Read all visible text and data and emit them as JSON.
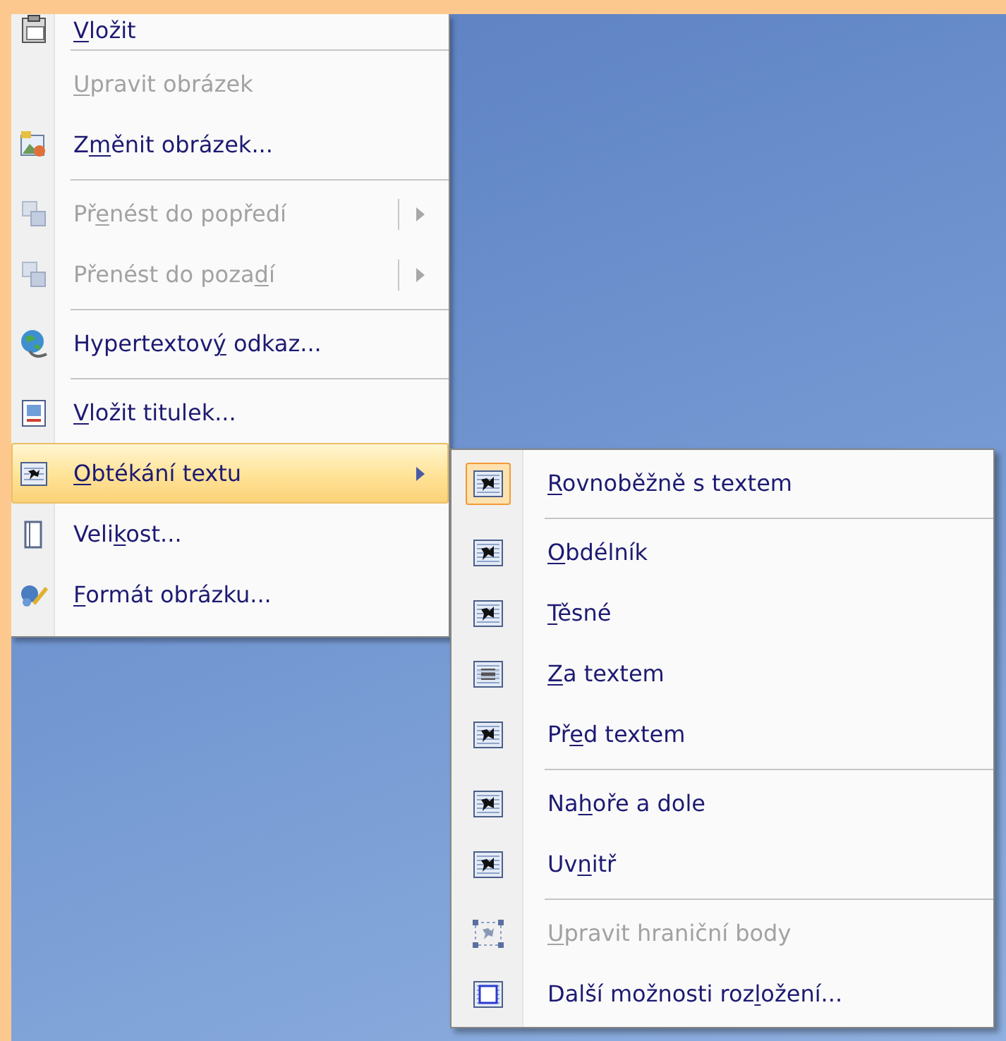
{
  "context_menu": {
    "items": [
      {
        "kind": "item",
        "label": [
          {
            "text": "V",
            "access_key": true
          },
          {
            "text": "ložit",
            "access_key": false
          }
        ],
        "disabled": false,
        "selected": false
      },
      {
        "kind": "separator"
      },
      {
        "kind": "item",
        "label": [
          {
            "text": "U",
            "access_key": true
          },
          {
            "text": "pravit obrázek",
            "access_key": false
          }
        ],
        "disabled": true,
        "selected": false
      },
      {
        "kind": "item",
        "label": [
          {
            "text": "Z",
            "access_key": false
          },
          {
            "text": "m",
            "access_key": true
          },
          {
            "text": "ěnit obrázek...",
            "access_key": false
          }
        ],
        "disabled": false,
        "selected": false
      },
      {
        "kind": "separator"
      },
      {
        "kind": "split",
        "label": [
          {
            "text": "Př",
            "access_key": false
          },
          {
            "text": "e",
            "access_key": true
          },
          {
            "text": "nést do popředí",
            "access_key": false
          }
        ],
        "disabled": true,
        "selected": false
      },
      {
        "kind": "split",
        "label": [
          {
            "text": "Přenést do poza",
            "access_key": false
          },
          {
            "text": "d",
            "access_key": true
          },
          {
            "text": "í",
            "access_key": false
          }
        ],
        "disabled": true,
        "selected": false
      },
      {
        "kind": "separator"
      },
      {
        "kind": "item",
        "label": [
          {
            "text": "Hypertextov",
            "access_key": false
          },
          {
            "text": "ý",
            "access_key": true
          },
          {
            "text": " odkaz...",
            "access_key": false
          }
        ],
        "disabled": false,
        "selected": false
      },
      {
        "kind": "separator"
      },
      {
        "kind": "item",
        "label": [
          {
            "text": "V",
            "access_key": true
          },
          {
            "text": "ložit titulek...",
            "access_key": false
          }
        ],
        "disabled": false,
        "selected": false
      },
      {
        "kind": "submenu",
        "label": [
          {
            "text": "O",
            "access_key": true
          },
          {
            "text": "btékání textu",
            "access_key": false
          }
        ],
        "disabled": false,
        "selected": true
      },
      {
        "kind": "item",
        "label": [
          {
            "text": "Veli",
            "access_key": false
          },
          {
            "text": "k",
            "access_key": true
          },
          {
            "text": "ost...",
            "access_key": false
          }
        ],
        "disabled": false,
        "selected": false
      },
      {
        "kind": "item",
        "label": [
          {
            "text": "F",
            "access_key": true
          },
          {
            "text": "ormát obrázku...",
            "access_key": false
          }
        ],
        "disabled": false,
        "selected": false
      }
    ]
  },
  "submenu": {
    "items": [
      {
        "kind": "item",
        "label": [
          {
            "text": "R",
            "access_key": true
          },
          {
            "text": "ovnoběžně s textem",
            "access_key": false
          }
        ],
        "checked": true,
        "disabled": false
      },
      {
        "kind": "separator"
      },
      {
        "kind": "item",
        "label": [
          {
            "text": "O",
            "access_key": true
          },
          {
            "text": "bdélník",
            "access_key": false
          }
        ],
        "checked": false,
        "disabled": false
      },
      {
        "kind": "item",
        "label": [
          {
            "text": "T",
            "access_key": true
          },
          {
            "text": "ěsné",
            "access_key": false
          }
        ],
        "checked": false,
        "disabled": false
      },
      {
        "kind": "item",
        "label": [
          {
            "text": "Z",
            "access_key": true
          },
          {
            "text": "a textem",
            "access_key": false
          }
        ],
        "checked": false,
        "disabled": false
      },
      {
        "kind": "item",
        "label": [
          {
            "text": "Př",
            "access_key": false
          },
          {
            "text": "e",
            "access_key": true
          },
          {
            "text": "d textem",
            "access_key": false
          }
        ],
        "checked": false,
        "disabled": false
      },
      {
        "kind": "separator"
      },
      {
        "kind": "item",
        "label": [
          {
            "text": "Na",
            "access_key": false
          },
          {
            "text": "h",
            "access_key": true
          },
          {
            "text": "oře a dole",
            "access_key": false
          }
        ],
        "checked": false,
        "disabled": false
      },
      {
        "kind": "item",
        "label": [
          {
            "text": "Uv",
            "access_key": false
          },
          {
            "text": "n",
            "access_key": true
          },
          {
            "text": "itř",
            "access_key": false
          }
        ],
        "checked": false,
        "disabled": false
      },
      {
        "kind": "separator"
      },
      {
        "kind": "item",
        "label": [
          {
            "text": "U",
            "access_key": true
          },
          {
            "text": "pravit hraniční body",
            "access_key": false
          }
        ],
        "checked": false,
        "disabled": true
      },
      {
        "kind": "item",
        "label": [
          {
            "text": "Další možnosti roz",
            "access_key": false
          },
          {
            "text": "l",
            "access_key": true
          },
          {
            "text": "ožení...",
            "access_key": false
          }
        ],
        "checked": false,
        "disabled": false
      }
    ]
  }
}
